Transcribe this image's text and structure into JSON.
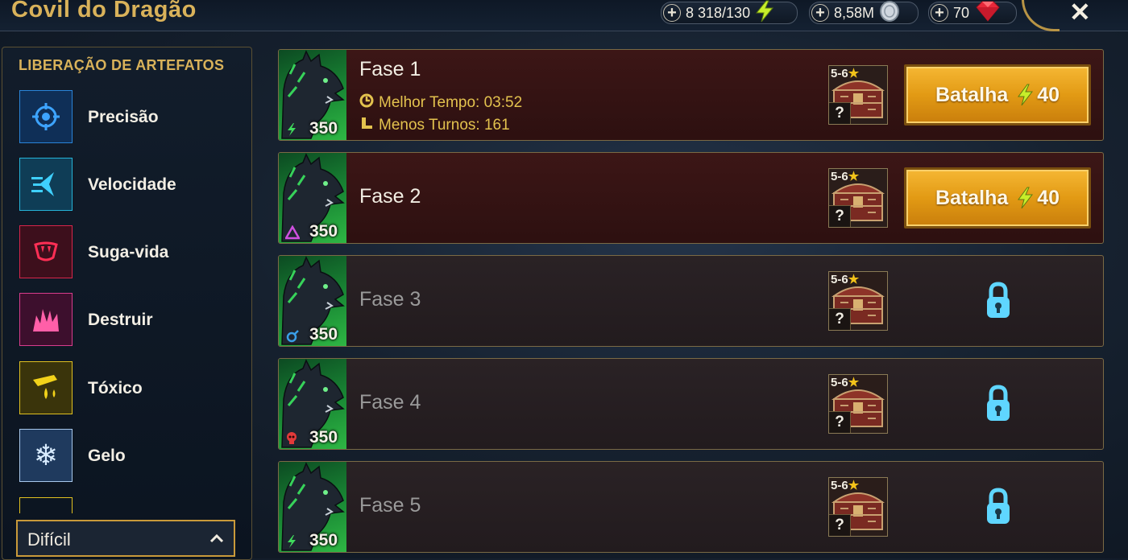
{
  "header": {
    "title": "Covil do Dragão",
    "energy": "8 318/130",
    "silver": "8,58M",
    "gems": "70",
    "close_icon": "close-icon"
  },
  "sidebar": {
    "heading": "LIBERAÇÃO DE ARTEFATOS",
    "items": [
      {
        "label": "Precisão",
        "icon": "crosshair-icon",
        "color": "#2a84d8"
      },
      {
        "label": "Velocidade",
        "icon": "speed-icon",
        "color": "#25b4d8"
      },
      {
        "label": "Suga-vida",
        "icon": "lifesteal-icon",
        "color": "#d8254a"
      },
      {
        "label": "Destruir",
        "icon": "destroy-icon",
        "color": "#d83c8c"
      },
      {
        "label": "Tóxico",
        "icon": "toxic-icon",
        "color": "#e0c020"
      },
      {
        "label": "Gelo",
        "icon": "snowflake-icon",
        "color": "#a8c8ec"
      }
    ],
    "difficulty": "Difícil"
  },
  "stages": [
    {
      "name": "Fase 1",
      "power": "350",
      "affinity": "magic-bolt-icon",
      "best_time": "Melhor Tempo: 03:52",
      "fewest_turns": "Menos Turnos: 161",
      "reward_stars": "5-6",
      "reward_q": "?",
      "battle_label": "Batalha",
      "battle_cost": "40",
      "locked": false
    },
    {
      "name": "Fase 2",
      "power": "350",
      "affinity": "triangle-icon",
      "reward_stars": "5-6",
      "reward_q": "?",
      "battle_label": "Batalha",
      "battle_cost": "40",
      "locked": false
    },
    {
      "name": "Fase 3",
      "power": "350",
      "affinity": "force-icon",
      "reward_stars": "5-6",
      "reward_q": "?",
      "locked": true
    },
    {
      "name": "Fase 4",
      "power": "350",
      "affinity": "skull-icon",
      "reward_stars": "5-6",
      "reward_q": "?",
      "locked": true
    },
    {
      "name": "Fase 5",
      "power": "350",
      "affinity": "magic-bolt-icon",
      "reward_stars": "5-6",
      "reward_q": "?",
      "locked": true
    }
  ],
  "colors": {
    "gold": "#d9b25a",
    "button": "#e29a14",
    "lock": "#5fd6ff"
  }
}
